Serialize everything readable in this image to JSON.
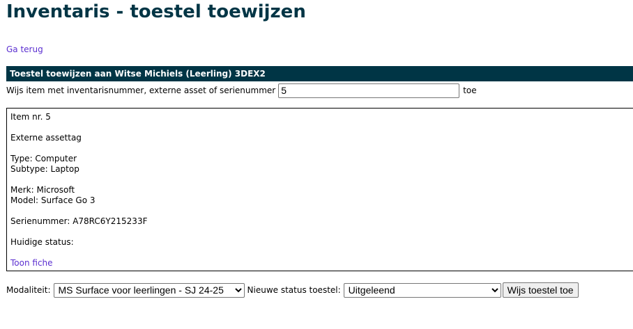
{
  "page": {
    "title": "Inventaris - toestel toewijzen"
  },
  "nav": {
    "back_label": "Ga terug"
  },
  "assign": {
    "header": "Toestel toewijzen aan Witse Michiels (Leerling) 3DEX2",
    "search_label": "Wijs item met inventarisnummer, externe asset of serienummer",
    "search_value": "5",
    "add_label": "toe"
  },
  "item": {
    "number": "Item nr. 5",
    "external_tag": "Externe assettag",
    "type": "Type: Computer",
    "subtype": "Subtype: Laptop",
    "brand": "Merk: Microsoft",
    "model": "Model: Surface Go 3",
    "serial": "Serienummer: A78RC6Y215233F",
    "status": "Huidige status:",
    "detail_link": "Toon fiche"
  },
  "form": {
    "modality_label": "Modaliteit:",
    "modality_value": "MS Surface voor leerlingen - SJ 24-25",
    "status_label": "Nieuwe status toestel:",
    "status_value": "Uitgeleend",
    "submit_label": "Wijs toestel toe"
  },
  "colors": {
    "header_bg": "#003545",
    "title": "#003545",
    "link": "#5b2fd0"
  }
}
